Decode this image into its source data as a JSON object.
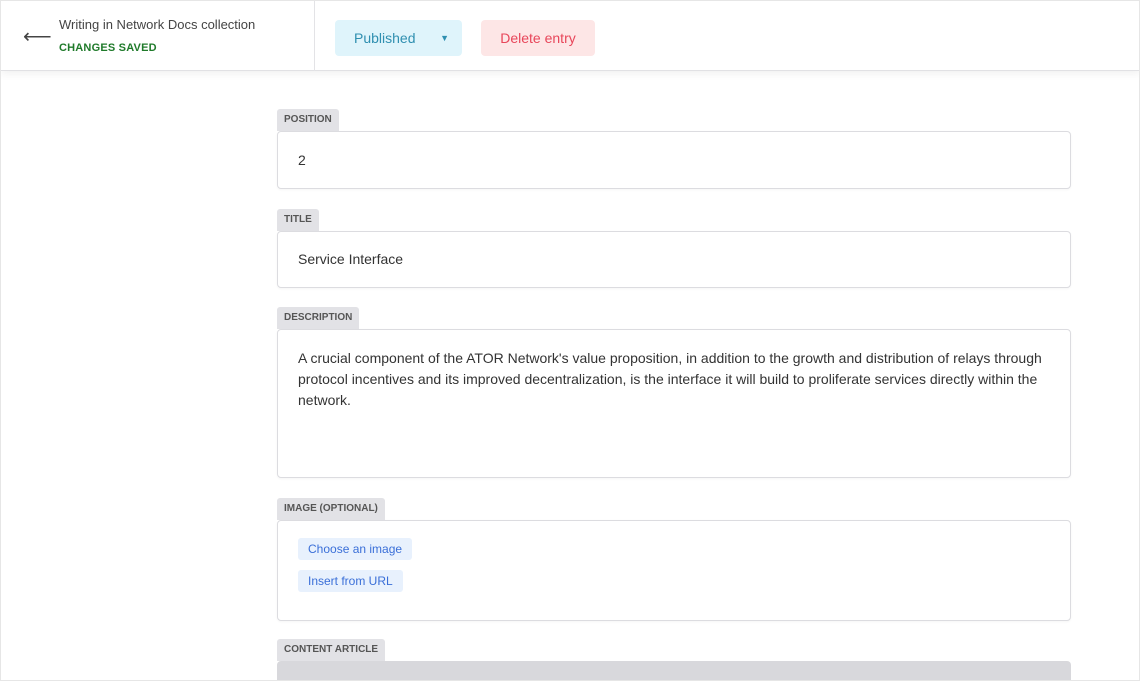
{
  "header": {
    "back_icon": "arrow-left-icon",
    "collection_title": "Writing in Network Docs collection",
    "save_status": "CHANGES SAVED",
    "status_button": "Published",
    "status_caret": "caret-down-icon",
    "delete_button": "Delete entry"
  },
  "fields": {
    "position": {
      "label": "POSITION",
      "value": "2"
    },
    "title": {
      "label": "TITLE",
      "value": "Service Interface"
    },
    "description": {
      "label": "DESCRIPTION",
      "value": "A crucial component of the ATOR Network's value proposition, in addition to the growth and distribution of relays through protocol incentives and its improved decentralization, is the interface it will build to proliferate services directly within the network."
    },
    "image": {
      "label": "IMAGE (OPTIONAL)",
      "choose_button": "Choose an image",
      "url_button": "Insert from URL"
    },
    "content": {
      "label": "CONTENT ARTICLE"
    }
  },
  "colors": {
    "published_bg": "#dff4fb",
    "published_text": "#2f8fb0",
    "delete_bg": "#fde6e6",
    "delete_text": "#e8465a",
    "saved_text": "#1f7a2a"
  }
}
